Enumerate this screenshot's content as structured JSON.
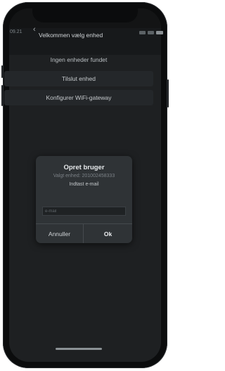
{
  "status": {
    "time": "09.21"
  },
  "nav": {
    "back_icon": "chevron-left-icon",
    "title": "Velkommen vælg enhed"
  },
  "list": {
    "items": [
      {
        "label": "Ingen enheder fundet"
      },
      {
        "label": "Tilslut enhed"
      },
      {
        "label": "Konfigurer WiFi-gateway"
      }
    ]
  },
  "dialog": {
    "title": "Opret bruger",
    "device": "Valgt enhed: 201002458333",
    "prompt": "Indtast e-mail",
    "email_placeholder": "e-mail",
    "cancel_label": "Annuller",
    "ok_label": "Ok"
  }
}
